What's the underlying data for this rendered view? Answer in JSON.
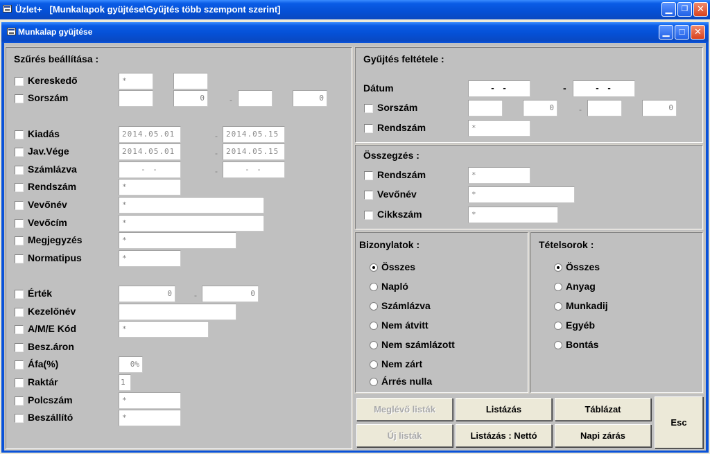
{
  "window": {
    "app_title": "Üzlet+",
    "path_title": "[Munkalapok gyüjtése\\Gyűjtés több szempont szerint]",
    "form_title": "Munkalap gyüjtése",
    "min_glyph": "▁",
    "max_glyph": "❐",
    "max2_glyph": "□",
    "close_glyph": "✕"
  },
  "filter": {
    "title": "Szűrés beállítása :",
    "kereskedo": {
      "label": "Kereskedő",
      "v1": "*",
      "v2": ""
    },
    "sorszam": {
      "label": "Sorszám",
      "v1": "",
      "v2": "0",
      "v3": "",
      "v4": "0"
    },
    "kiadas": {
      "label": "Kiadás",
      "from": "2014.05.01",
      "to": "2014.05.15"
    },
    "javvege": {
      "label": "Jav.Vége",
      "from": "2014.05.01",
      "to": "2014.05.15"
    },
    "szamlazva": {
      "label": "Számlázva",
      "from": "-  -",
      "to": "-  -"
    },
    "rendszam": {
      "label": "Rendszám",
      "value": "*"
    },
    "vevonev": {
      "label": "Vevőnév",
      "value": "*"
    },
    "vevocim": {
      "label": "Vevőcím",
      "value": "*"
    },
    "megjegyzes": {
      "label": "Megjegyzés",
      "value": "*"
    },
    "normatipus": {
      "label": "Normatipus",
      "value": "*"
    },
    "ertek": {
      "label": "Érték",
      "from": "0",
      "to": "0"
    },
    "kezelonev": {
      "label": "Kezelőnév",
      "value": ""
    },
    "amekod": {
      "label": "A/M/E Kód",
      "value": "*"
    },
    "beszaron": {
      "label": "Besz.áron"
    },
    "afa": {
      "label": "Áfa(%)",
      "value": "0%"
    },
    "raktar": {
      "label": "Raktár",
      "value": "1"
    },
    "polcszam": {
      "label": "Polcszám",
      "value": "*"
    },
    "beszallito": {
      "label": "Beszállító",
      "value": "*"
    },
    "range_sep": "-"
  },
  "collect": {
    "title": "Gyűjtés feltétele :",
    "datum": {
      "label": "Dátum",
      "from": "-  -",
      "to": "-  -",
      "sep": "-"
    },
    "sorszam": {
      "label": "Sorszám",
      "v1": "",
      "v2": "0",
      "v3": "",
      "v4": "0"
    },
    "rendszam": {
      "label": "Rendszám",
      "value": "*"
    }
  },
  "summary": {
    "title": "Összegzés :",
    "rendszam": {
      "label": "Rendszám",
      "value": "*"
    },
    "vevonev": {
      "label": "Vevőnév",
      "value": "*"
    },
    "cikkszam": {
      "label": "Cikkszám",
      "value": "*"
    }
  },
  "docs": {
    "title": "Bizonylatok :",
    "options": [
      "Összes",
      "Napló",
      "Számlázva",
      "Nem átvitt",
      "Nem számlázott",
      "Nem zárt",
      "Árrés nulla"
    ],
    "selected": 0
  },
  "items": {
    "title": "Tételsorok :",
    "options": [
      "Összes",
      "Anyag",
      "Munkadij",
      "Egyéb",
      "Bontás"
    ],
    "selected": 0
  },
  "buttons": {
    "meglevo": "Meglévő listák",
    "uj": "Új listák",
    "listazas": "Listázás",
    "listazas_netto": "Listázás : Nettó",
    "tablazat": "Táblázat",
    "napi_zaras": "Napi zárás",
    "esc": "Esc"
  }
}
